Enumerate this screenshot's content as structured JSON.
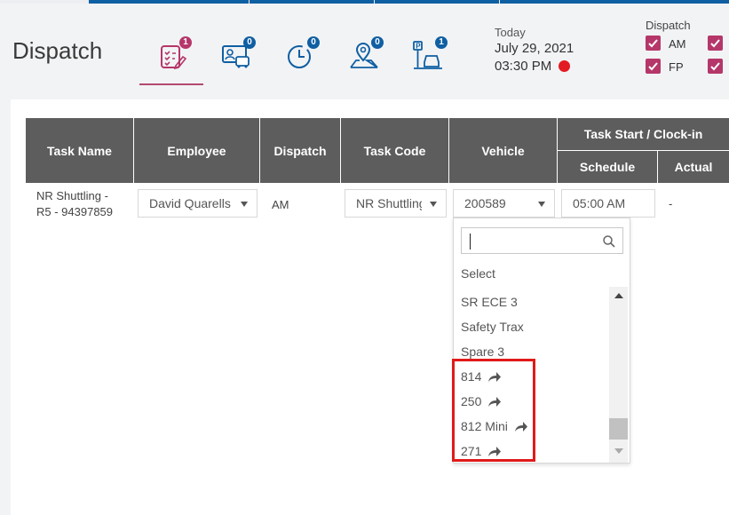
{
  "page": {
    "title": "Dispatch"
  },
  "nav": [
    {
      "name": "tasks",
      "badge": "1",
      "badge_color": "#b5376a",
      "active": true
    },
    {
      "name": "employees",
      "badge": "0",
      "badge_color": "#0f5fa3"
    },
    {
      "name": "clock",
      "badge": "0",
      "badge_color": "#0f5fa3"
    },
    {
      "name": "map",
      "badge": "0",
      "badge_color": "#0f5fa3"
    },
    {
      "name": "parking",
      "badge": "1",
      "badge_color": "#0f5fa3"
    }
  ],
  "header": {
    "today_label": "Today",
    "date": "July 29, 2021",
    "time": "03:30 PM",
    "live_color": "#e31b23"
  },
  "dispatch_filter": {
    "label": "Dispatch",
    "options": [
      {
        "label": "AM",
        "checked": true
      },
      {
        "label": "FP",
        "checked": true
      },
      {
        "label": "",
        "checked": true
      },
      {
        "label": "",
        "checked": true
      }
    ]
  },
  "table": {
    "columns": {
      "task_name": "Task Name",
      "employee": "Employee",
      "dispatch": "Dispatch",
      "task_code": "Task Code",
      "vehicle": "Vehicle",
      "task_start_group": "Task Start / Clock-in",
      "schedule": "Schedule",
      "actual": "Actual"
    },
    "row": {
      "task_name_line1": "NR Shuttling -",
      "task_name_line2": "R5 - 94397859",
      "employee": "David Quarells",
      "dispatch": "AM",
      "task_code": "NR Shuttling",
      "vehicle": "200589",
      "schedule": "05:00 AM",
      "actual": "-"
    }
  },
  "vehicle_dropdown": {
    "search_value": "",
    "placeholder_item": "Select",
    "items": [
      {
        "label": "SR ECE 3",
        "linked": false
      },
      {
        "label": "Safety Trax",
        "linked": false
      },
      {
        "label": "Spare 3",
        "linked": false
      },
      {
        "label": "814",
        "linked": true
      },
      {
        "label": "250",
        "linked": true
      },
      {
        "label": "812 Mini",
        "linked": true
      },
      {
        "label": "271",
        "linked": true
      }
    ]
  },
  "colors": {
    "accent": "#b5376a",
    "brand_blue": "#0f5fa3",
    "header_gray": "#5d5d5d",
    "highlight_red": "#e11a1a"
  }
}
